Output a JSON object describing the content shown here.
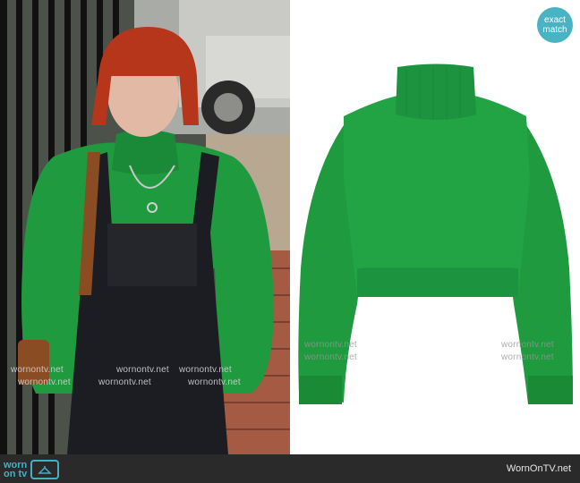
{
  "badge": {
    "line1": "exact",
    "line2": "match"
  },
  "watermark": "wornontv.net",
  "footer": {
    "logo_top": "worn",
    "logo_bottom": "on tv",
    "site": "WornOnTV.net"
  },
  "colors": {
    "sweater": "#1f9a3f",
    "badge": "#49b3c4",
    "footer": "#2a2a2a"
  }
}
